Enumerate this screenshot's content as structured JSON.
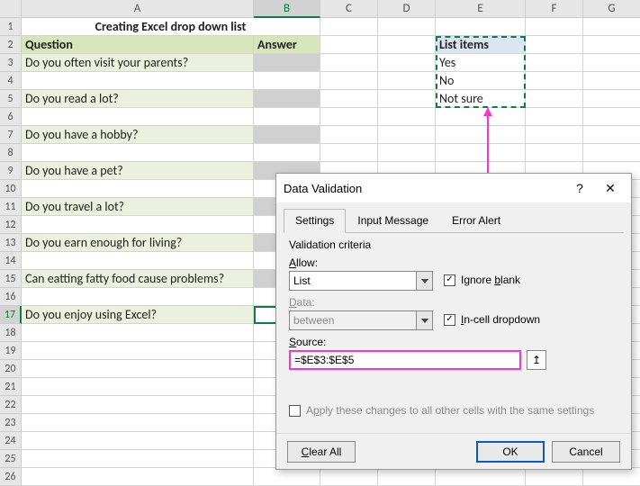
{
  "columns": [
    "A",
    "B",
    "C",
    "D",
    "E",
    "F",
    "G"
  ],
  "colWidths": [
    "wA",
    "wB",
    "wC",
    "wD",
    "wE",
    "wF",
    "wG"
  ],
  "activeColIndex": 1,
  "activeRowIndex": 16,
  "rows": 26,
  "sheet": {
    "title": "Creating Excel drop down list",
    "header": {
      "question": "Question",
      "answer": "Answer",
      "listitems": "List items"
    },
    "questions": [
      "Do you often visit your parents?",
      "",
      "Do you read a lot?",
      "",
      "Do you have a hobby?",
      "",
      "Do you have a pet?",
      "",
      "Do you travel a lot?",
      "",
      "Do you earn enough for living?",
      "",
      "Can eatting fatty food cause problems?",
      "",
      "Do you enjoy using Excel?"
    ],
    "listitems": [
      "Yes",
      "No",
      "Not sure"
    ]
  },
  "dialog": {
    "title": "Data Validation",
    "tabs": {
      "settings": "Settings",
      "input": "Input Message",
      "error": "Error Alert"
    },
    "criteria_label": "Validation criteria",
    "allow_label": "Allow:",
    "allow_value": "List",
    "data_label": "Data:",
    "data_value": "between",
    "ignore_blank": "Ignore blank",
    "incell": "In-cell dropdown",
    "source_label": "Source:",
    "source_value": "=$E$3:$E$5",
    "apply": "Apply these changes to all other cells with the same settings",
    "clear": "Clear All",
    "ok": "OK",
    "cancel": "Cancel"
  }
}
